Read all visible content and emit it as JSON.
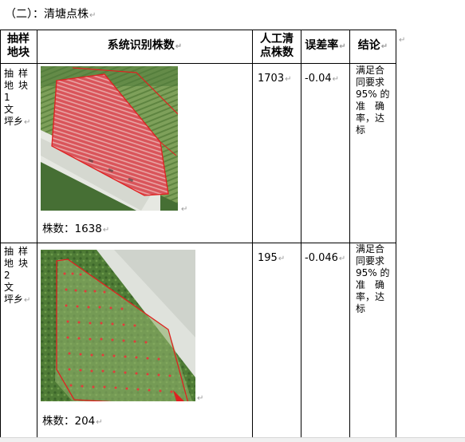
{
  "heading": "（二）：清塘点株",
  "table": {
    "headers": {
      "plot": "抽样地块",
      "system": "系统识别株数",
      "manual": "人工清点株数",
      "error": "误差率",
      "conclusion": "结论"
    },
    "rows": [
      {
        "plot_lines": [
          "抽样",
          "地块",
          "1 文",
          "坪乡"
        ],
        "count_label": "株数：1638",
        "manual": "1703",
        "error": "-0.04",
        "conclusion_lines": [
          "满足合",
          "同要求",
          "95% 的",
          "准确",
          "率，达",
          "标"
        ]
      },
      {
        "plot_lines": [
          "抽样",
          "地块",
          "2 文",
          "坪乡"
        ],
        "count_label": "株数：204",
        "manual": "195",
        "error": "-0.046",
        "conclusion_lines": [
          "满足合",
          "同要求",
          "95% 的",
          "准确",
          "率，达",
          "标"
        ]
      }
    ]
  },
  "colors": {
    "outline": "#e02020",
    "field_green": "#5f8c43",
    "dirt": "#d9dcd4"
  }
}
